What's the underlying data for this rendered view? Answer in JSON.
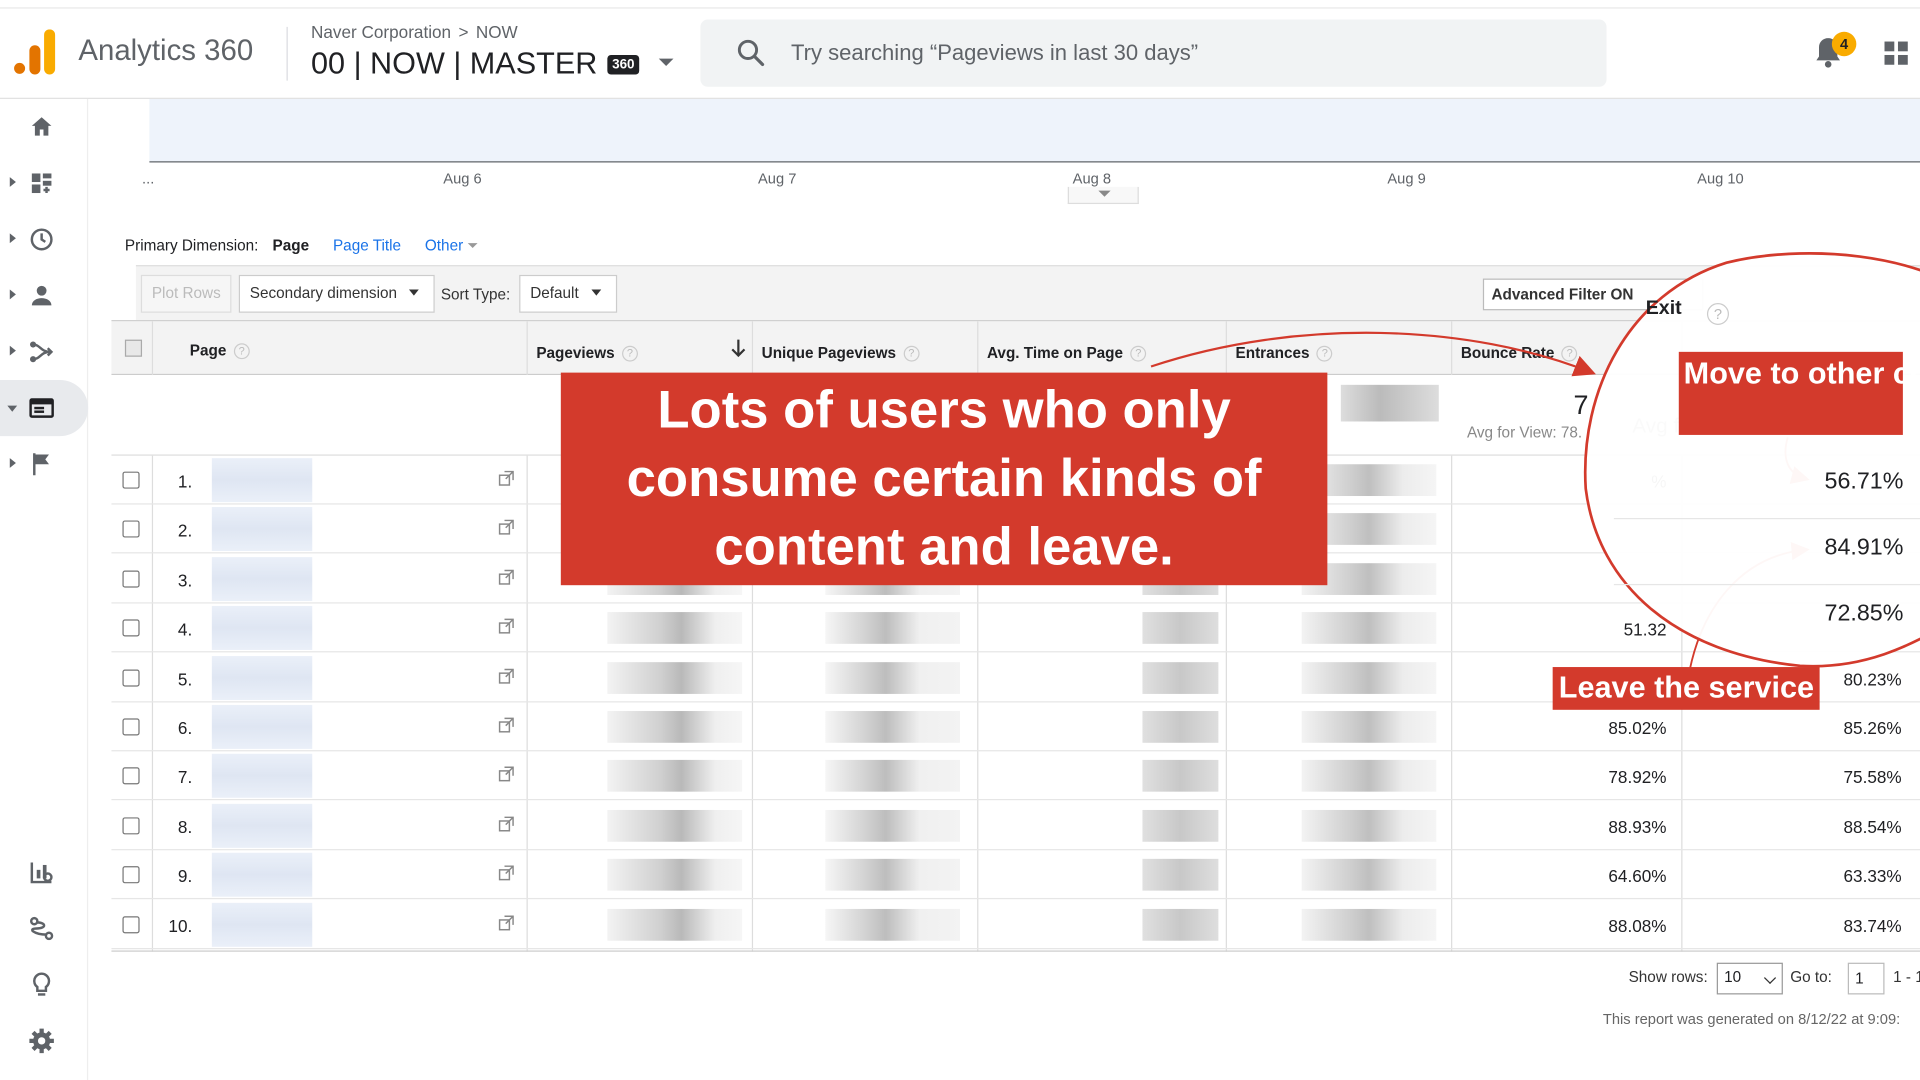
{
  "header": {
    "app_name": "Analytics 360",
    "breadcrumb": [
      "Naver Corporation",
      "NOW"
    ],
    "breadcrumb_sep": ">",
    "view_name": "00 | NOW | MASTER",
    "view_badge": "360",
    "search_placeholder": "Try searching “Pageviews in last 30 days”",
    "notification_count": "4"
  },
  "sidebar": {
    "items": [
      {
        "icon": "home-icon"
      },
      {
        "icon": "customization-icon"
      },
      {
        "icon": "realtime-icon"
      },
      {
        "icon": "audience-icon"
      },
      {
        "icon": "acquisition-icon"
      },
      {
        "icon": "behavior-icon",
        "active": true
      },
      {
        "icon": "conversions-icon"
      }
    ],
    "bottom_items": [
      {
        "icon": "attribution-icon"
      },
      {
        "icon": "discover-icon"
      },
      {
        "icon": "lightbulb-icon"
      },
      {
        "icon": "gear-icon"
      }
    ]
  },
  "chart": {
    "x_ticks": [
      "...",
      "Aug 6",
      "Aug 7",
      "Aug 8",
      "Aug 9",
      "Aug 10"
    ]
  },
  "primary_dimension": {
    "label": "Primary Dimension:",
    "current": "Page",
    "options": [
      "Page Title",
      "Other"
    ]
  },
  "toolbar": {
    "plot_rows": "Plot Rows",
    "secondary_dimension": "Secondary dimension",
    "sort_type_label": "Sort Type:",
    "sort_type_value": "Default",
    "advanced_filter": "Advanced Filter ON"
  },
  "table": {
    "columns": {
      "page": "Page",
      "pageviews": "Pageviews",
      "unique_pageviews": "Unique Pageviews",
      "avg_time": "Avg. Time on Page",
      "entrances": "Entrances",
      "bounce_rate": "Bounce Rate",
      "exit": "Exit"
    },
    "totals": {
      "bounce_rate_value": "7",
      "bounce_rate_sub": "Avg for View: 78.",
      "exit_sub": "Avg f"
    },
    "rows": [
      {
        "num": "1.",
        "bounce_rate": "%",
        "exit": ""
      },
      {
        "num": "2.",
        "bounce_rate": "",
        "exit": ""
      },
      {
        "num": "3.",
        "bounce_rate": "",
        "exit": ""
      },
      {
        "num": "4.",
        "bounce_rate": "51.32",
        "exit": ""
      },
      {
        "num": "5.",
        "bounce_rate": "",
        "exit": "80.23%"
      },
      {
        "num": "6.",
        "bounce_rate": "85.02%",
        "exit": "85.26%"
      },
      {
        "num": "7.",
        "bounce_rate": "78.92%",
        "exit": "75.58%"
      },
      {
        "num": "8.",
        "bounce_rate": "88.93%",
        "exit": "88.54%"
      },
      {
        "num": "9.",
        "bounce_rate": "64.60%",
        "exit": "63.33%"
      },
      {
        "num": "10.",
        "bounce_rate": "88.08%",
        "exit": "83.74%"
      }
    ]
  },
  "footer": {
    "show_rows_label": "Show rows:",
    "show_rows_value": "10",
    "goto_label": "Go to:",
    "goto_value": "1",
    "page_range": "1 - 1",
    "generated": "This report was generated on 8/12/22 at 9:09:"
  },
  "annotations": {
    "callout": "Lots of users who only consume certain kinds of content and leave.",
    "move_label": "Move to other contents",
    "leave_label": "Leave the service",
    "zoom_values": [
      "56.71%",
      "84.91%",
      "72.85%"
    ],
    "zoom_header": "Exit",
    "color_red": "#d33a2c"
  }
}
